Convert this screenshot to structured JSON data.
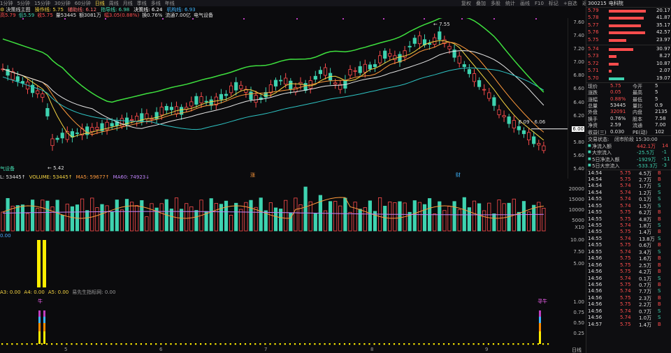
{
  "toolbar": {
    "tabs": [
      "1分钟",
      "5分钟",
      "15分钟",
      "30分钟",
      "60分钟",
      "日线",
      "周线",
      "月线",
      "季线",
      "多线",
      "年线"
    ],
    "active_tab": "日线",
    "right_items": [
      "复权",
      "叠加",
      "多股",
      "统计",
      "画线",
      "F10",
      "标记",
      "+自选",
      "返回"
    ]
  },
  "indicator_line": {
    "title": "决策线主图",
    "items": [
      {
        "label": "操作线: 5.75",
        "color": "#f5d442"
      },
      {
        "label": "辅助线: 6.12",
        "color": "#ff6f6f"
      },
      {
        "label": "指导线: 6.98",
        "color": "#46e0b4"
      },
      {
        "label": "决策线: 6.24",
        "color": "#ffffff"
      },
      {
        "label": "机构线: 6.93",
        "color": "#3fb6ff"
      }
    ]
  },
  "info_line": {
    "items": [
      {
        "label": "高5.79",
        "color": "#ff4d4d"
      },
      {
        "label": "低5.59",
        "color": "#3ed3b0"
      },
      {
        "label": "收5.75",
        "color": "#ff4d4d"
      },
      {
        "label": "量53445",
        "color": "#e0e0e0"
      },
      {
        "label": "额3081万",
        "color": "#e0e0e0"
      },
      {
        "label": "幅3.05(0.88%)",
        "color": "#ff4d4d"
      },
      {
        "label": "换0.76%",
        "color": "#e0e0e0"
      },
      {
        "label": "流通7.00亿",
        "color": "#e0e0e0"
      },
      {
        "label": "电气设备",
        "color": "#e0e0e0"
      }
    ]
  },
  "main_chart": {
    "y_ticks": [
      "7.60",
      "7.40",
      "7.20",
      "7.00",
      "6.80",
      "6.60",
      "6.40",
      "6.20",
      "6.00",
      "5.80",
      "5.60",
      "5.40"
    ],
    "annotation_high": "7.55",
    "annotation_low": "5.42",
    "annotation_range": "6.09 - 6.06",
    "sector_label": "气设备",
    "marker_1": "涨",
    "marker_2": "财"
  },
  "volume": {
    "header": [
      {
        "label": "L: 53445↑",
        "color": "#e0e0e0"
      },
      {
        "label": "VOLUME: 53445↑",
        "color": "#f5d442"
      },
      {
        "label": "MA5: 59677↑",
        "color": "#ff9a3c"
      },
      {
        "label": "MA60: 74923↓",
        "color": "#c084fc"
      }
    ],
    "y_ticks": [
      "20000",
      "15000",
      "10000",
      "5000"
    ],
    "unit": "X10"
  },
  "bar_panel": {
    "header": "0.00",
    "y_ticks": [
      "10.00",
      "7.50",
      "5.00"
    ]
  },
  "a_panel": {
    "header": [
      {
        "label": "A3: 0.00",
        "color": "#f5d442"
      },
      {
        "label": "A4: 0.00",
        "color": "#f5d442"
      },
      {
        "label": "A5: 0.00",
        "color": "#f5d442"
      },
      {
        "label": "易先生指标网: 0.00",
        "color": "#9a9a9a"
      }
    ],
    "y_ticks": [
      "1.00",
      "0.75",
      "0.50",
      "0.25"
    ],
    "signal_label": "牛",
    "signal_label_2": "寻牛"
  },
  "x_axis": {
    "ticks": [
      "5",
      "6",
      "7",
      "8",
      "9"
    ],
    "period_label": "日线"
  },
  "panel": {
    "code": "300215",
    "name": "电科院",
    "orderbook": [
      {
        "price": "5.79",
        "vol": "20.17",
        "bar": 0.95
      },
      {
        "price": "5.78",
        "vol": "41.87",
        "bar": 0.9
      },
      {
        "price": "5.77",
        "vol": "35.17",
        "bar": 0.82
      },
      {
        "price": "5.76",
        "vol": "42.57",
        "bar": 0.92
      },
      {
        "price": "5.75",
        "vol": "23.97",
        "bar": 0.45
      },
      {
        "price": "5.74",
        "vol": "30.97",
        "bar": 0.62
      },
      {
        "price": "5.73",
        "vol": "8.27",
        "bar": 0.2
      },
      {
        "price": "5.72",
        "vol": "10.87",
        "bar": 0.25
      },
      {
        "price": "5.71",
        "vol": "2.07",
        "bar": 0.08
      },
      {
        "price": "5.70",
        "vol": "19.07",
        "bar": 0.4
      }
    ],
    "stats": [
      {
        "l1": "现价",
        "v1": "5.75",
        "c1": "red",
        "l2": "今开",
        "v2": "5"
      },
      {
        "l1": "涨跌",
        "v1": "0.05",
        "c1": "red",
        "l2": "最高",
        "v2": "5"
      },
      {
        "l1": "涨幅",
        "v1": "0.88%",
        "c1": "red",
        "l2": "最低",
        "v2": "5"
      },
      {
        "l1": "总量",
        "v1": "53445",
        "c1": "white",
        "l2": "量比",
        "v2": "0.9"
      },
      {
        "l1": "外盘",
        "v1": "32091",
        "c1": "red",
        "l2": "内盘",
        "v2": "2135"
      },
      {
        "l1": "换手",
        "v1": "0.76%",
        "c1": "white",
        "l2": "股本",
        "v2": "7.58"
      },
      {
        "l1": "净资",
        "v1": "2.59",
        "c1": "white",
        "l2": "流通",
        "v2": "7.00"
      },
      {
        "l1": "收益(三)",
        "v1": "0.030",
        "c1": "white",
        "l2": "PE(动)",
        "v2": "102"
      }
    ],
    "trade_status_label": "交易状态:",
    "trade_status_value": "闭市阶段 15:30:00",
    "flows": [
      {
        "label": "净流入额",
        "value": "442.1万",
        "extra": "14",
        "color": "red"
      },
      {
        "label": "大宗流入",
        "value": "-25.5万",
        "extra": "-1",
        "color": "green"
      },
      {
        "label": "5日净流入额",
        "value": "-1929万",
        "extra": "-11",
        "color": "green"
      },
      {
        "label": "5日大宗流入",
        "value": "-533.3万",
        "extra": "-3",
        "color": "green"
      }
    ],
    "ticks": [
      {
        "t": "14:54",
        "p": "5.75",
        "v": "4.5万",
        "d": "B"
      },
      {
        "t": "14:54",
        "p": "5.75",
        "v": "2.7万",
        "d": "B"
      },
      {
        "t": "14:54",
        "p": "5.74",
        "v": "1.7万",
        "d": "S"
      },
      {
        "t": "14:54",
        "p": "5.74",
        "v": "1.2万",
        "d": "S"
      },
      {
        "t": "14:55",
        "p": "5.74",
        "v": "0.1万",
        "d": "S"
      },
      {
        "t": "14:55",
        "p": "5.74",
        "v": "1.5万",
        "d": "S"
      },
      {
        "t": "14:55",
        "p": "5.75",
        "v": "6.2万",
        "d": "B"
      },
      {
        "t": "14:55",
        "p": "5.75",
        "v": "4.8万",
        "d": "B"
      },
      {
        "t": "14:55",
        "p": "5.74",
        "v": "1.8万",
        "d": "S"
      },
      {
        "t": "14:55",
        "p": "5.75",
        "v": "1.4万",
        "d": "B"
      },
      {
        "t": "14:55",
        "p": "5.74",
        "v": "13.8万",
        "d": "S"
      },
      {
        "t": "14:55",
        "p": "5.75",
        "v": "0.6万",
        "d": "B"
      },
      {
        "t": "14:55",
        "p": "5.74",
        "v": "3.4万",
        "d": "S"
      },
      {
        "t": "14:56",
        "p": "5.75",
        "v": "1.6万",
        "d": "B"
      },
      {
        "t": "14:56",
        "p": "5.75",
        "v": "2.5万",
        "d": "B"
      },
      {
        "t": "14:56",
        "p": "5.75",
        "v": "4.2万",
        "d": "B"
      },
      {
        "t": "14:56",
        "p": "5.74",
        "v": "0.1万",
        "d": "S"
      },
      {
        "t": "14:56",
        "p": "5.75",
        "v": "0.7万",
        "d": "B"
      },
      {
        "t": "14:56",
        "p": "5.74",
        "v": "7.7万",
        "d": "S"
      },
      {
        "t": "14:56",
        "p": "5.75",
        "v": "2.3万",
        "d": "B"
      },
      {
        "t": "14:56",
        "p": "5.75",
        "v": "2.2万",
        "d": "B"
      },
      {
        "t": "14:56",
        "p": "5.74",
        "v": "0.7万",
        "d": "S"
      },
      {
        "t": "14:56",
        "p": "5.74",
        "v": "1.0万",
        "d": "S"
      },
      {
        "t": "14:57",
        "p": "5.75",
        "v": "1.4万",
        "d": "B"
      }
    ]
  },
  "colors": {
    "up": "#ff4d4d",
    "down": "#3ed3b0",
    "ma_green": "#3ee03e",
    "ma_white": "#e8e8e8",
    "ma_orange": "#ff9a3c",
    "ma_yellow": "#f5d442",
    "ma_cyan": "#2ec4c4"
  }
}
